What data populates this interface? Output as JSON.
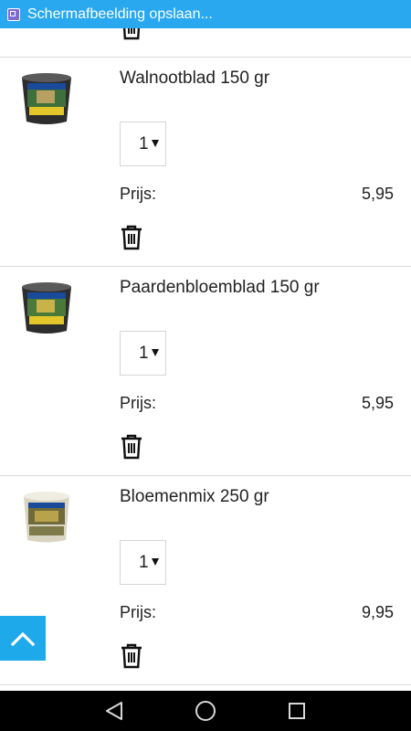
{
  "status_bar": {
    "notification_text": "Schermafbeelding opslaan...",
    "icon": "screenshot-icon",
    "background_color": "#29a8f0"
  },
  "cart": {
    "price_label": "Prijs:",
    "items": [
      {
        "name": "Walnootblad 150 gr",
        "quantity": "1",
        "price": "5,95",
        "image": "product-bucket-image"
      },
      {
        "name": "Paardenbloemblad 150 gr",
        "quantity": "1",
        "price": "5,95",
        "image": "product-bucket-image"
      },
      {
        "name": "Bloemenmix 250 gr",
        "quantity": "1",
        "price": "9,95",
        "image": "product-bucket-image"
      }
    ]
  },
  "scroll_to_top": {
    "icon": "chevron-up-icon",
    "color": "#1ea9ea"
  },
  "nav_bar": {
    "back_icon": "back-icon",
    "home_icon": "home-icon",
    "recents_icon": "recents-icon"
  }
}
